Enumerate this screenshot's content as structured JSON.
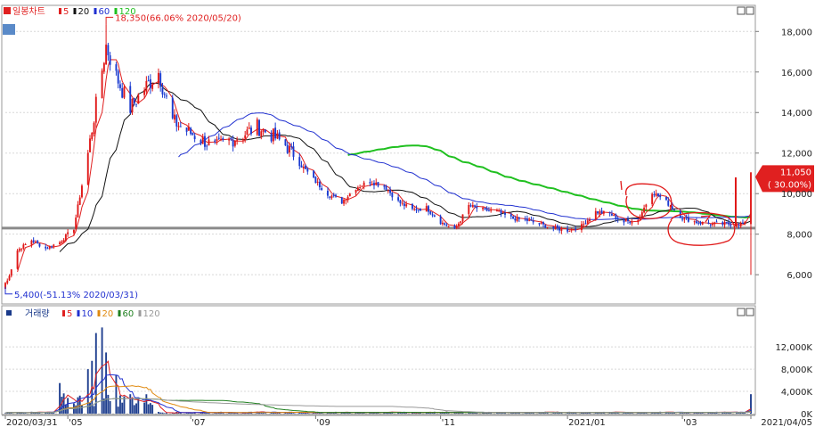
{
  "legend_price": {
    "title": "일봉차트",
    "ma": [
      {
        "label": "5",
        "color": "#e02020"
      },
      {
        "label": "20",
        "color": "#111111"
      },
      {
        "label": "60",
        "color": "#2030d0"
      },
      {
        "label": "120",
        "color": "#20c020"
      }
    ]
  },
  "legend_volume": {
    "title": "거래량",
    "ma": [
      {
        "label": "5",
        "color": "#e02020"
      },
      {
        "label": "10",
        "color": "#2030d0"
      },
      {
        "label": "20",
        "color": "#e08a10"
      },
      {
        "label": "60",
        "color": "#208020"
      },
      {
        "label": "120",
        "color": "#9a9a9a"
      }
    ]
  },
  "annotations": {
    "high": "18,350(66.06% 2020/05/20)",
    "low": "5,400(-51.13% 2020/03/31)",
    "current_price": "11,050",
    "current_pct": "( 30.00%)"
  },
  "chart_data": [
    {
      "type": "candlestick",
      "title": "",
      "ylim": [
        4600,
        19200
      ],
      "yticks": [
        6000,
        8000,
        10000,
        12000,
        14000,
        16000,
        18000
      ],
      "ytick_labels": [
        "6,000",
        "8,000",
        "10,000",
        "12,000",
        "14,000",
        "16,000",
        "18,000"
      ],
      "support_line": 8300,
      "x_tick_labels": [
        "2020/03/31",
        "'05",
        "'07",
        "'09",
        "'11",
        "2021/01",
        "'03",
        "2021/04/05"
      ],
      "x_ticks": [
        "2020/03/31",
        "2020/05/01",
        "2020/07/01",
        "2020/09/01",
        "2020/11/02",
        "2021/01/04",
        "2021/03/02",
        "2021/04/05"
      ],
      "x_range": [
        "2020/03/31",
        "2021/04/05"
      ],
      "close_series": [
        [
          "2020/03/31",
          5400
        ],
        [
          "2020/04/06",
          7200
        ],
        [
          "2020/04/13",
          7700
        ],
        [
          "2020/04/20",
          7300
        ],
        [
          "2020/04/27",
          7600
        ],
        [
          "2020/05/04",
          8300
        ],
        [
          "2020/05/11",
          12000
        ],
        [
          "2020/05/20",
          17300
        ],
        [
          "2020/05/25",
          15800
        ],
        [
          "2020/06/01",
          14200
        ],
        [
          "2020/06/08",
          15200
        ],
        [
          "2020/06/15",
          16000
        ],
        [
          "2020/06/22",
          13600
        ],
        [
          "2020/06/29",
          13100
        ],
        [
          "2020/07/06",
          12700
        ],
        [
          "2020/07/13",
          12300
        ],
        [
          "2020/07/20",
          12600
        ],
        [
          "2020/07/27",
          12900
        ],
        [
          "2020/08/03",
          13300
        ],
        [
          "2020/08/10",
          12900
        ],
        [
          "2020/08/17",
          12400
        ],
        [
          "2020/08/24",
          11500
        ],
        [
          "2020/08/31",
          10700
        ],
        [
          "2020/09/07",
          10000
        ],
        [
          "2020/09/14",
          9600
        ],
        [
          "2020/09/21",
          10300
        ],
        [
          "2020/09/28",
          10600
        ],
        [
          "2020/10/05",
          10400
        ],
        [
          "2020/10/12",
          9600
        ],
        [
          "2020/10/19",
          9200
        ],
        [
          "2020/10/26",
          9300
        ],
        [
          "2020/11/02",
          8600
        ],
        [
          "2020/11/09",
          8200
        ],
        [
          "2020/11/16",
          9400
        ],
        [
          "2020/11/23",
          9200
        ],
        [
          "2020/11/30",
          9100
        ],
        [
          "2020/12/07",
          8800
        ],
        [
          "2020/12/14",
          8700
        ],
        [
          "2020/12/21",
          8500
        ],
        [
          "2020/12/28",
          8300
        ],
        [
          "2021/01/04",
          8200
        ],
        [
          "2021/01/11",
          8400
        ],
        [
          "2021/01/18",
          9100
        ],
        [
          "2021/01/25",
          9000
        ],
        [
          "2021/02/01",
          8600
        ],
        [
          "2021/02/08",
          8700
        ],
        [
          "2021/02/15",
          10100
        ],
        [
          "2021/02/22",
          9600
        ],
        [
          "2021/03/02",
          8800
        ],
        [
          "2021/03/09",
          8600
        ],
        [
          "2021/03/16",
          8500
        ],
        [
          "2021/03/23",
          8500
        ],
        [
          "2021/03/30",
          8500
        ],
        [
          "2021/04/02",
          8500
        ],
        [
          "2021/04/05",
          11050
        ]
      ],
      "high_point": [
        "2020/05/20",
        18350
      ],
      "low_point": [
        "2020/03/31",
        5400
      ],
      "last_day": {
        "date": "2021/04/05",
        "open": 8500,
        "high": 11050,
        "low": 6000,
        "close": 11050
      },
      "ma_period_days": {
        "ma5": 5,
        "ma20": 20,
        "ma60": 60,
        "ma120": 120
      },
      "ma60_start": [
        "2020/06/25",
        10000
      ],
      "ma120_start": [
        "2020/09/17",
        10700
      ]
    },
    {
      "type": "bar",
      "title": "",
      "unit": "K",
      "ylim": [
        0,
        17000
      ],
      "yticks": [
        0,
        4000,
        8000,
        12000
      ],
      "ytick_labels": [
        "0K",
        "4,000K",
        "8,000K",
        "12,000K"
      ],
      "spikes": [
        [
          "2020/04/27",
          5500
        ],
        [
          "2020/05/11",
          8000
        ],
        [
          "2020/05/13",
          9500
        ],
        [
          "2020/05/15",
          14500
        ],
        [
          "2020/05/18",
          15500
        ],
        [
          "2020/05/20",
          11000
        ],
        [
          "2020/05/25",
          7000
        ],
        [
          "2020/06/01",
          3500
        ],
        [
          "2021/04/05",
          3500
        ]
      ],
      "base_level": 250
    }
  ]
}
